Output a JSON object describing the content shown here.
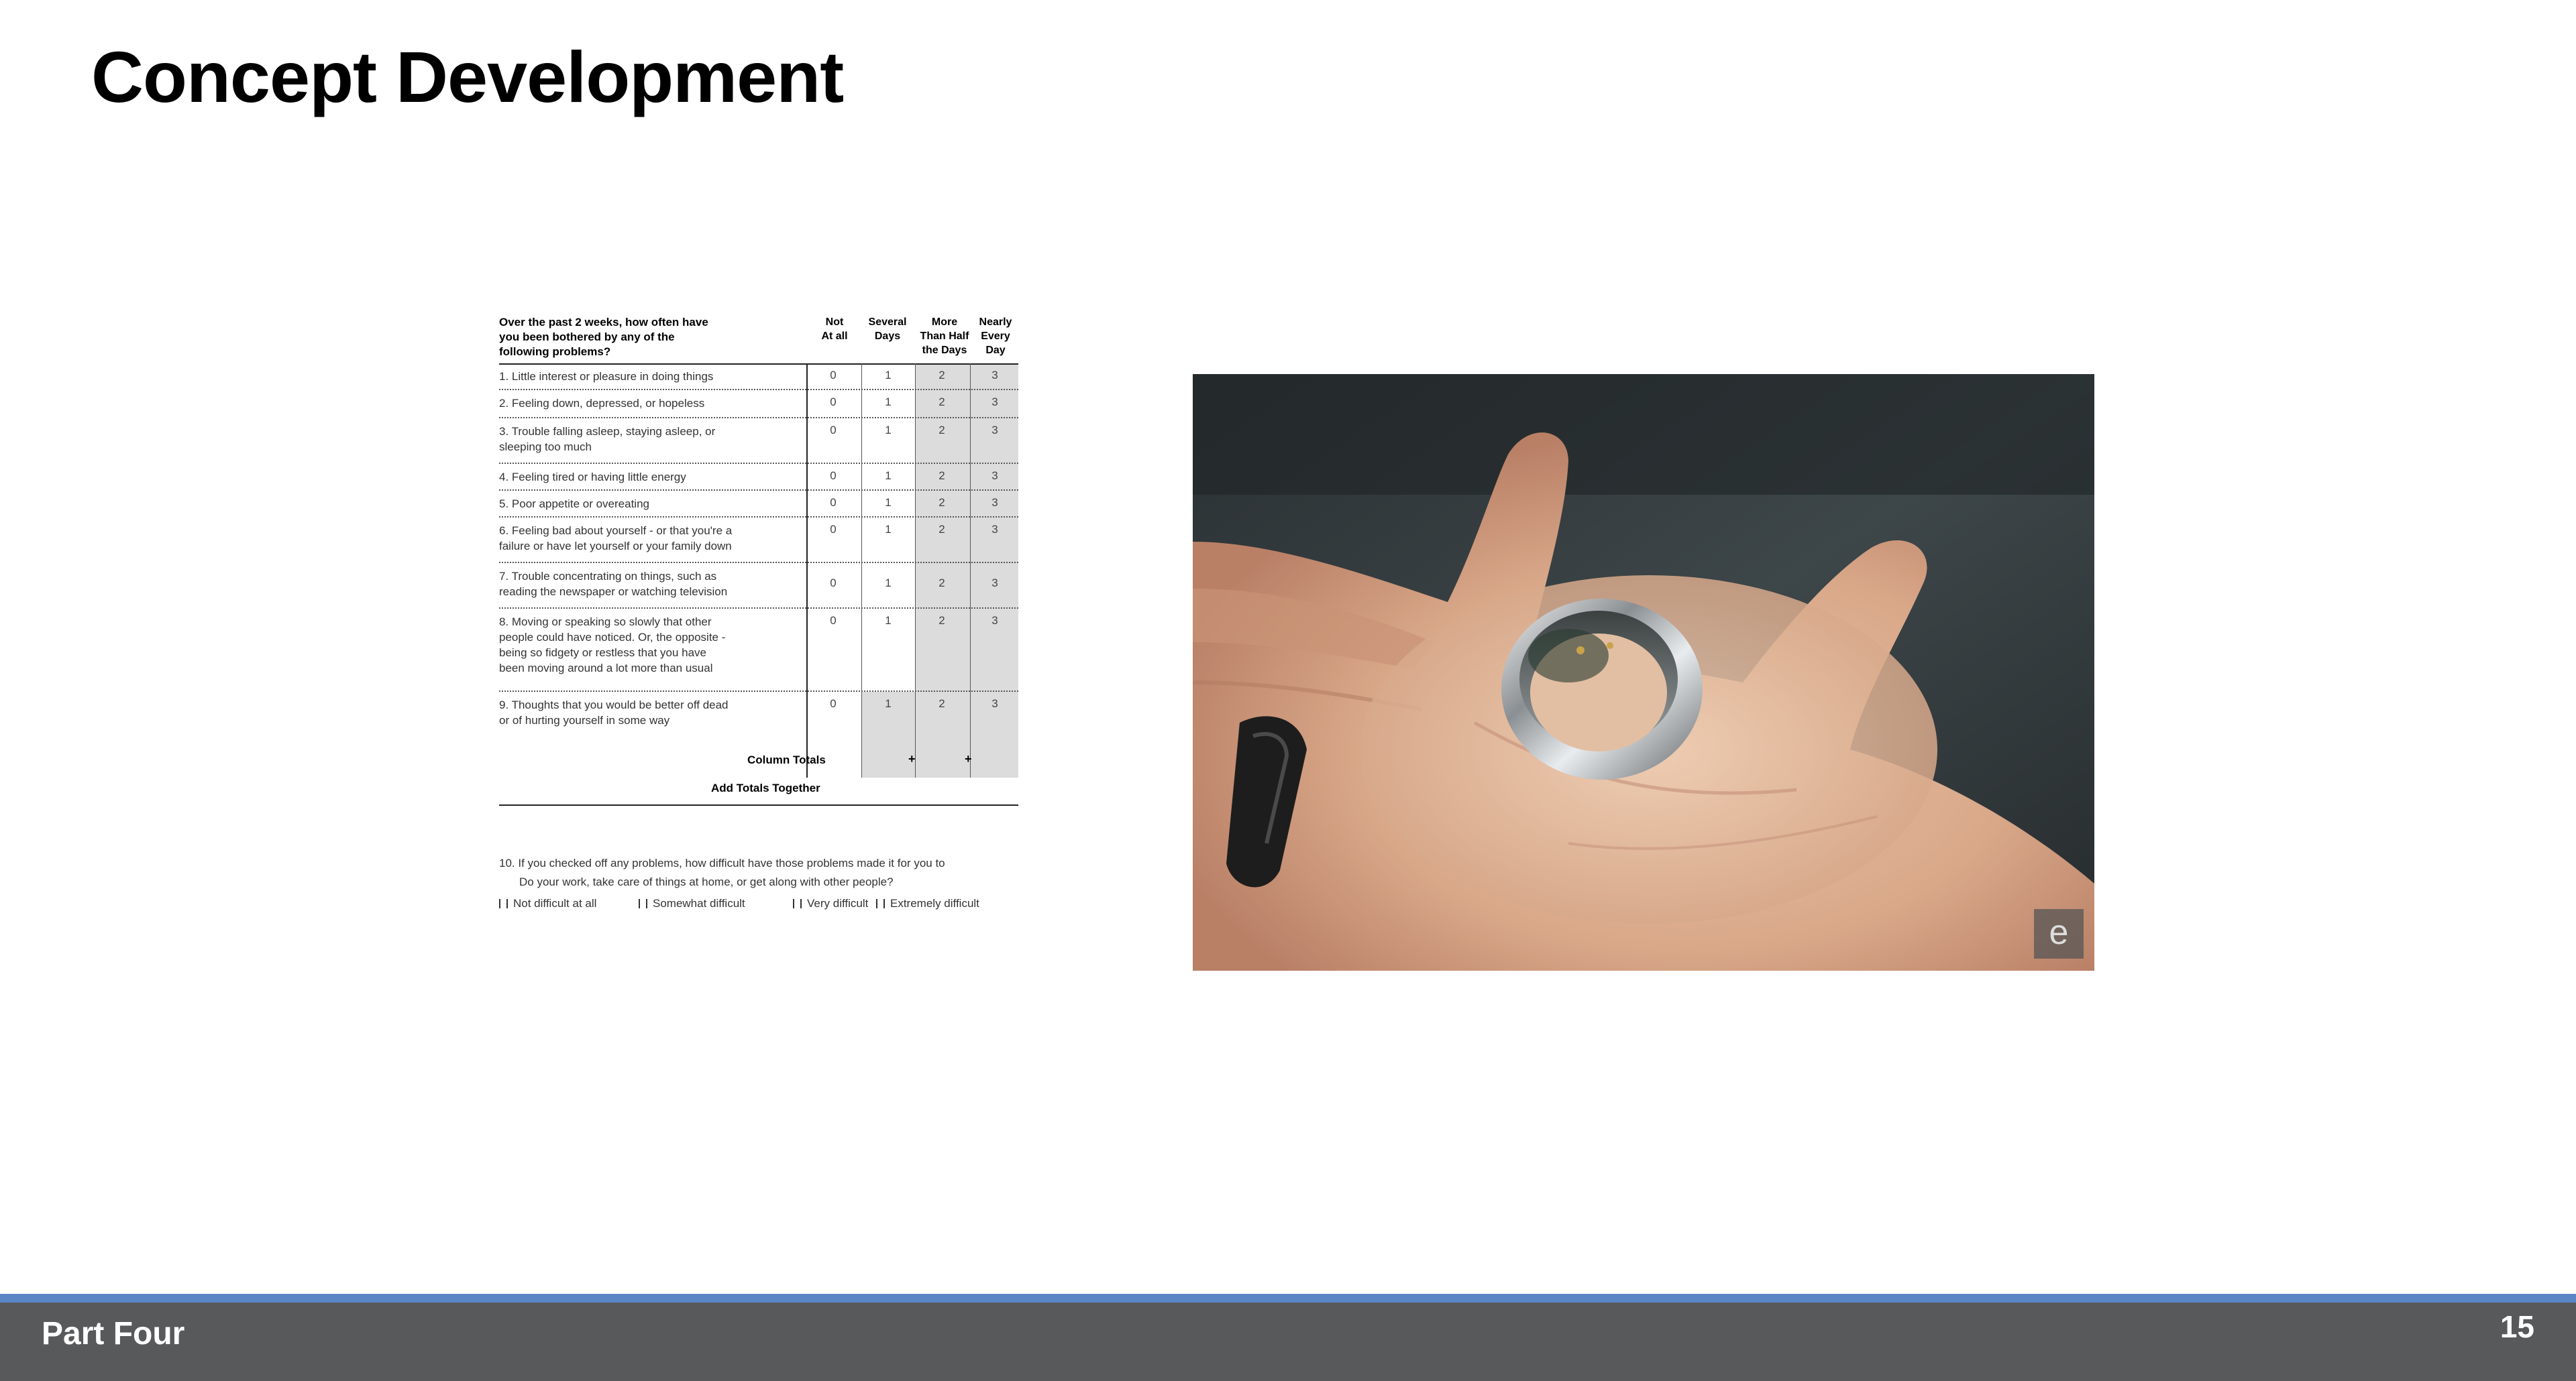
{
  "slide": {
    "title": "Concept Development",
    "section": "Part Four",
    "page_number": "15"
  },
  "questionnaire": {
    "prompt": "Over the past 2 weeks, how often have\nyou been bothered by any of the\nfollowing problems?",
    "columns": [
      "Not\nAt all",
      "Several\nDays",
      "More\nThan Half\nthe Days",
      "Nearly\nEvery\nDay"
    ],
    "items": [
      {
        "text": "1.  Little interest or pleasure in doing things",
        "scores": [
          "0",
          "1",
          "2",
          "3"
        ]
      },
      {
        "text": "2.  Feeling down, depressed, or hopeless",
        "scores": [
          "0",
          "1",
          "2",
          "3"
        ]
      },
      {
        "text": "3.  Trouble falling asleep, staying asleep, or\n     sleeping too much",
        "scores": [
          "0",
          "1",
          "2",
          "3"
        ]
      },
      {
        "text": "4.  Feeling tired or having little energy",
        "scores": [
          "0",
          "1",
          "2",
          "3"
        ]
      },
      {
        "text": "5.  Poor appetite or overeating",
        "scores": [
          "0",
          "1",
          "2",
          "3"
        ]
      },
      {
        "text": "6.  Feeling bad about yourself - or that you're a\n     failure or have let yourself or your family down",
        "scores": [
          "0",
          "1",
          "2",
          "3"
        ]
      },
      {
        "text": "7.  Trouble concentrating on things, such as\n     reading the newspaper or watching television",
        "scores": [
          "0",
          "1",
          "2",
          "3"
        ]
      },
      {
        "text": "8.  Moving or speaking so slowly that other\n     people could have noticed. Or, the opposite -\n     being so fidgety or restless that you have\n     been moving around a lot more than usual",
        "scores": [
          "0",
          "1",
          "2",
          "3"
        ]
      },
      {
        "text": "9.  Thoughts that you would be better off dead\n     or of hurting yourself in some way",
        "scores": [
          "0",
          "1",
          "2",
          "3"
        ]
      }
    ],
    "column_totals_label": "Column Totals",
    "plus_sign": "+",
    "add_totals_label": "Add Totals Together",
    "followup_line1": "10. If you checked off any problems, how difficult have those problems made it for you to",
    "followup_line2": "Do your work, take care of things at home, or get along with other people?",
    "options": [
      "Not difficult at all",
      "Somewhat difficult",
      "Very difficult",
      "Extremely difficult"
    ]
  },
  "photo": {
    "watermark": "e"
  }
}
